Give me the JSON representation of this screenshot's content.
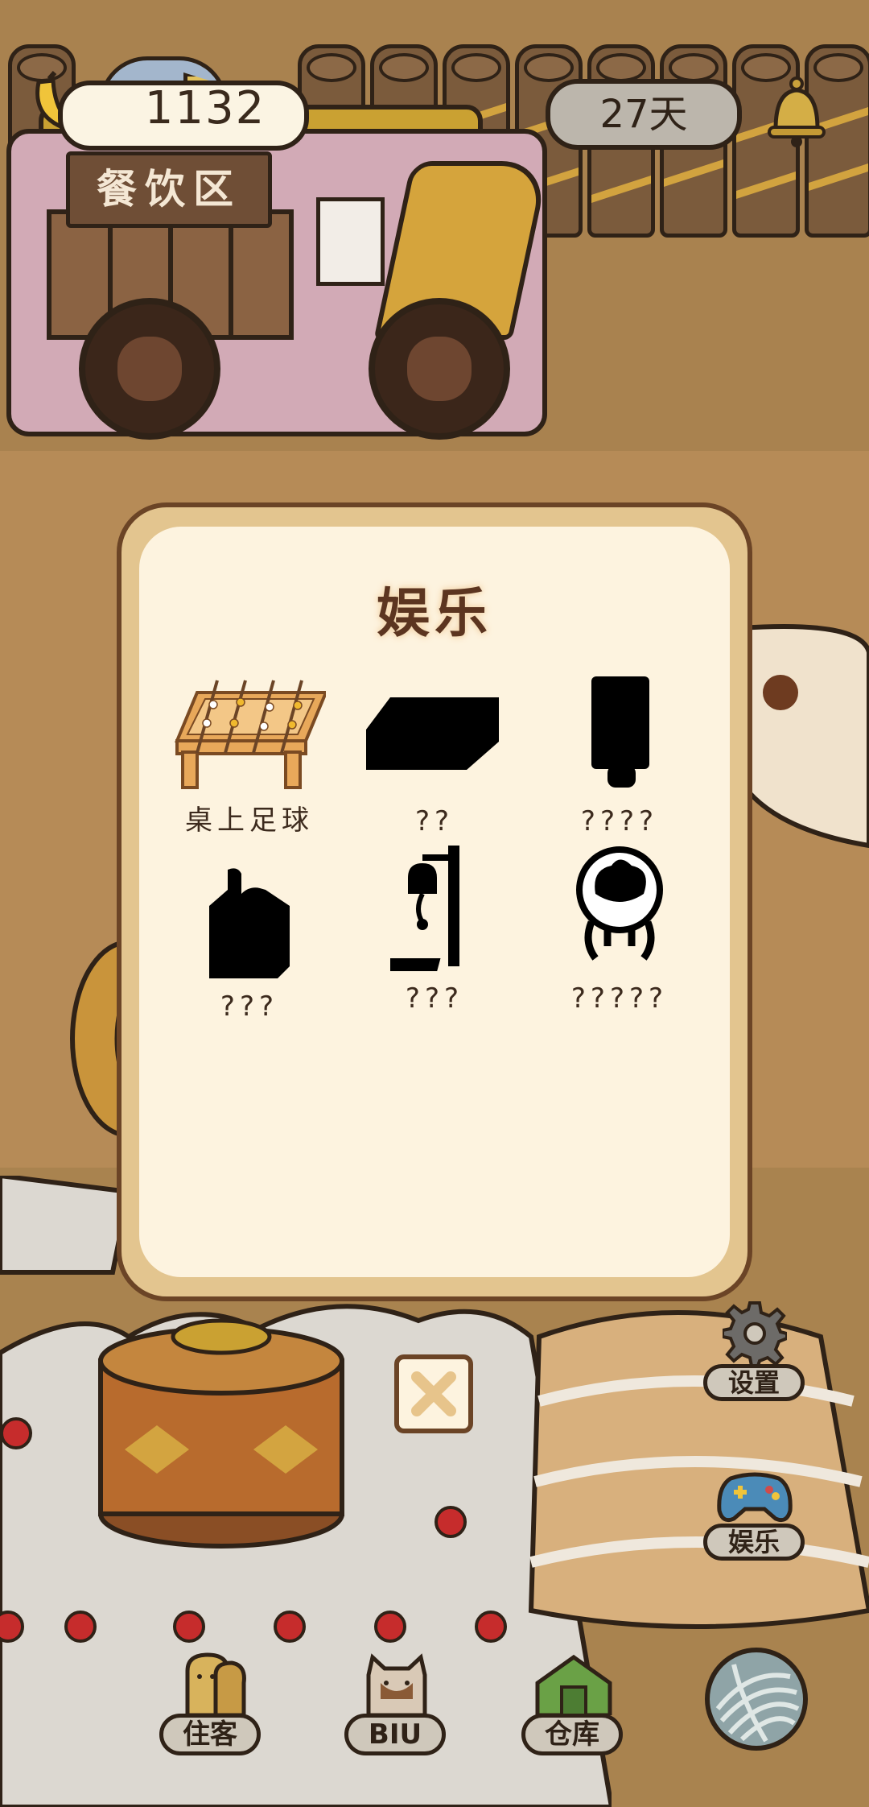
{
  "topbar": {
    "coins": "1132",
    "days": "27天",
    "zone_sign": "餐饮区"
  },
  "modal": {
    "title": "娱乐",
    "items": [
      {
        "label": "桌上足球",
        "unlocked": true
      },
      {
        "label": "??",
        "unlocked": false
      },
      {
        "label": "????",
        "unlocked": false
      },
      {
        "label": "???",
        "unlocked": false
      },
      {
        "label": "???",
        "unlocked": false
      },
      {
        "label": "?????",
        "unlocked": false
      }
    ]
  },
  "side_menu": {
    "settings_label": "设置",
    "entertainment_label": "娱乐"
  },
  "bottom_nav": {
    "guests_label": "住客",
    "biu_label": "BIU",
    "warehouse_label": "仓库"
  },
  "colors": {
    "modal_border": "#6b4426",
    "modal_bg": "#fdf3df",
    "title": "#5c3520",
    "silhouette": "#000000"
  }
}
